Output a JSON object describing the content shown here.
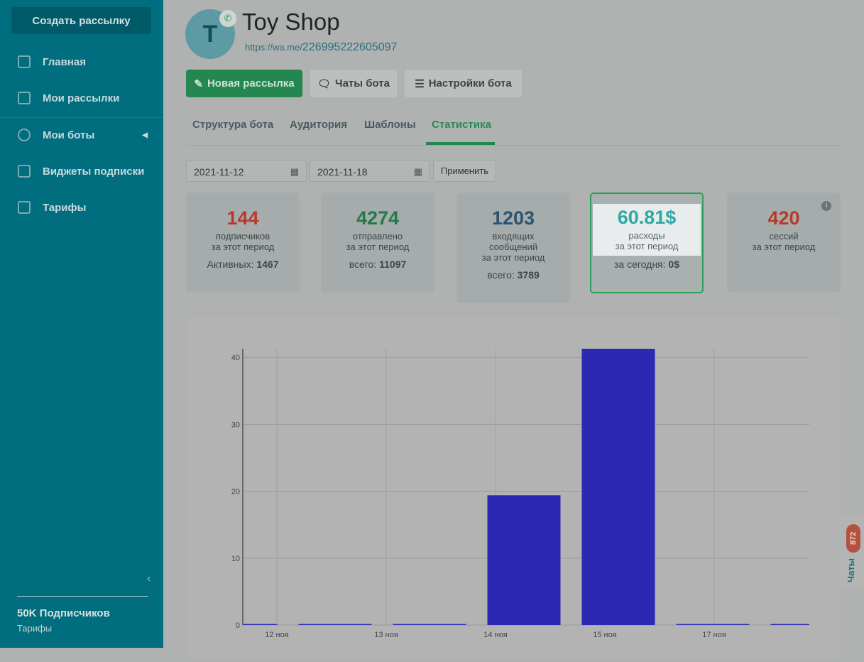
{
  "sidebar": {
    "create_label": "Создать рассылку",
    "items": [
      {
        "label": "Главная"
      },
      {
        "label": "Мои рассылки"
      },
      {
        "label": "Мои боты"
      },
      {
        "label": "Виджеты подписки"
      },
      {
        "label": "Тарифы"
      }
    ],
    "plan": "50K Подписчиков",
    "plan_link": "Тарифы"
  },
  "bot": {
    "avatar_letter": "T",
    "title": "Toy Shop",
    "link_prefix": "https://wa.me/",
    "link_number": "226995222605097"
  },
  "actions": {
    "new_mailing": "Новая рассылка",
    "bot_chats": "Чаты бота",
    "bot_settings": "Настройки бота"
  },
  "tabs": [
    {
      "label": "Структура бота"
    },
    {
      "label": "Аудитория"
    },
    {
      "label": "Шаблоны"
    },
    {
      "label": "Статистика"
    }
  ],
  "filter": {
    "date_from": "2021-11-12",
    "date_to": "2021-11-18",
    "apply": "Применить"
  },
  "cards": [
    {
      "value": "144",
      "l1": "подписчиков",
      "l2": "за этот период",
      "sub_label": "Активных:",
      "sub_value": "1467",
      "color": "#b63a2b"
    },
    {
      "value": "4274",
      "l1": "отправлено",
      "l2": "за этот период",
      "sub_label": "всего:",
      "sub_value": "11097",
      "color": "#237a4a"
    },
    {
      "value": "1203",
      "l1": "входящих",
      "l1b": "сообщений",
      "l2": "за этот период",
      "sub_label": "всего:",
      "sub_value": "3789",
      "color": "#2b5470"
    },
    {
      "value": "60.81$",
      "l1": "расходы",
      "l2": "за этот период",
      "sub_label": "за сегодня:",
      "sub_value": "0$",
      "color": "#2eaaa6"
    },
    {
      "value": "420",
      "l1": "сессий",
      "l2": "за этот период",
      "color": "#b63a2b"
    }
  ],
  "chats_tab": {
    "label": "Чаты",
    "count": "872"
  },
  "chart_data": {
    "type": "bar",
    "title": "",
    "xlabel": "",
    "ylabel": "",
    "ylim": [
      0,
      41.3
    ],
    "yticks": [
      "0",
      "10",
      "20",
      "30",
      "40"
    ],
    "xtick_labels": [
      "12 ноя",
      "13 ноя",
      "14 ноя",
      "15 ноя",
      "17 ноя"
    ],
    "values": [
      0,
      0,
      0,
      19.4,
      41.3,
      0,
      0
    ],
    "bar_color": "#2b28b3"
  }
}
